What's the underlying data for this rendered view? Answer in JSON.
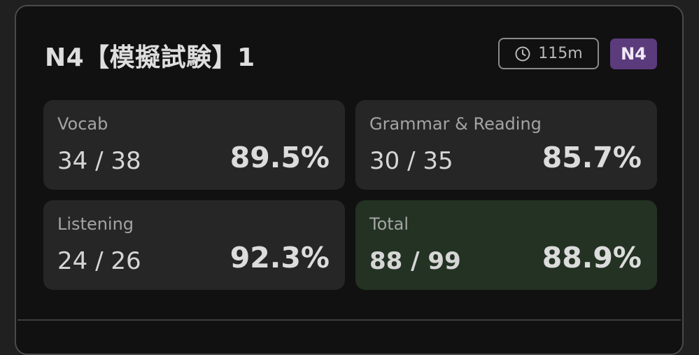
{
  "exam": {
    "title": "N4【模擬試験】1",
    "duration": "115m",
    "level": "N4"
  },
  "stats": [
    {
      "label": "Vocab",
      "score": "34 / 38",
      "percent": "89.5%"
    },
    {
      "label": "Grammar & Reading",
      "score": "30 / 35",
      "percent": "85.7%"
    },
    {
      "label": "Listening",
      "score": "24 / 26",
      "percent": "92.3%"
    },
    {
      "label": "Total",
      "score": "88 / 99",
      "percent": "88.9%"
    }
  ],
  "colors": {
    "card_bg": "#111111",
    "stat_bg": "#262626",
    "total_bg": "#233223",
    "badge_bg": "#5b3b7c"
  },
  "icons": {
    "duration": "clock-icon"
  }
}
